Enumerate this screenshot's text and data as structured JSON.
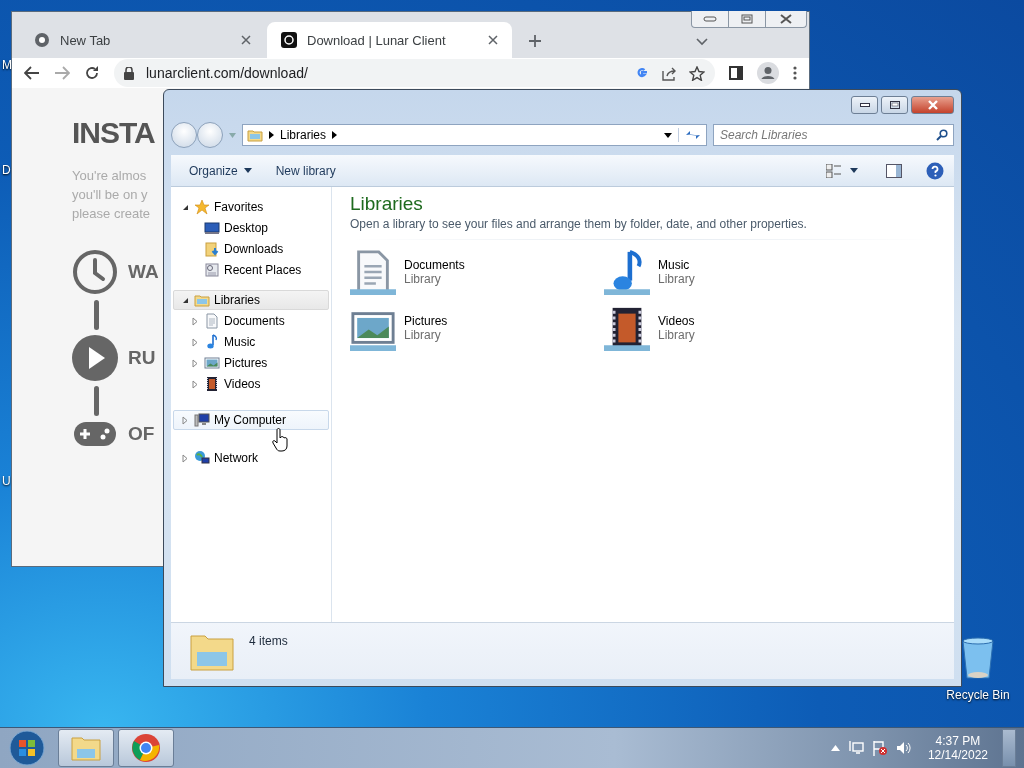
{
  "desktop": {
    "icon_label_fragments": [
      "M",
      "D",
      "U"
    ],
    "recycle_bin": "Recycle Bin"
  },
  "browser": {
    "tabs": [
      {
        "title": "New Tab",
        "selected": false
      },
      {
        "title": "Download | Lunar Client",
        "selected": true
      }
    ],
    "url": "lunarclient.com/download/",
    "page": {
      "heading": "INSTA",
      "paragraph_lines": [
        "You're almos",
        "you'll be on y",
        "please create"
      ],
      "steps": [
        {
          "kind": "clock",
          "label": "WA"
        },
        {
          "kind": "play",
          "label": "RU"
        },
        {
          "kind": "gamepad",
          "label": "OF"
        }
      ]
    }
  },
  "explorer": {
    "breadcrumb": [
      "Libraries"
    ],
    "search": {
      "placeholder": "Search Libraries"
    },
    "toolbar": [
      {
        "label": "Organize",
        "dropdown": true
      },
      {
        "label": "New library",
        "dropdown": false
      }
    ],
    "nav": [
      {
        "label": "Favorites",
        "expanded": true,
        "selected": false,
        "hovered": false,
        "children": [
          {
            "label": "Desktop"
          },
          {
            "label": "Downloads"
          },
          {
            "label": "Recent Places"
          }
        ]
      },
      {
        "label": "Libraries",
        "expanded": true,
        "selected": true,
        "hovered": false,
        "children": [
          {
            "label": "Documents",
            "expanded": false
          },
          {
            "label": "Music",
            "expanded": false
          },
          {
            "label": "Pictures",
            "expanded": false
          },
          {
            "label": "Videos",
            "expanded": false
          }
        ]
      },
      {
        "label": "My Computer",
        "expanded": false,
        "selected": false,
        "hovered": true
      },
      {
        "label": "Network",
        "expanded": false,
        "selected": false,
        "hovered": false
      }
    ],
    "content": {
      "title": "Libraries",
      "description": "Open a library to see your files and arrange them by folder, date, and other properties.",
      "items": [
        {
          "name": "Documents",
          "type": "Library"
        },
        {
          "name": "Music",
          "type": "Library"
        },
        {
          "name": "Pictures",
          "type": "Library"
        },
        {
          "name": "Videos",
          "type": "Library"
        }
      ]
    },
    "status": "4 items"
  },
  "taskbar": {
    "time": "4:37 PM",
    "date": "12/14/2022"
  }
}
